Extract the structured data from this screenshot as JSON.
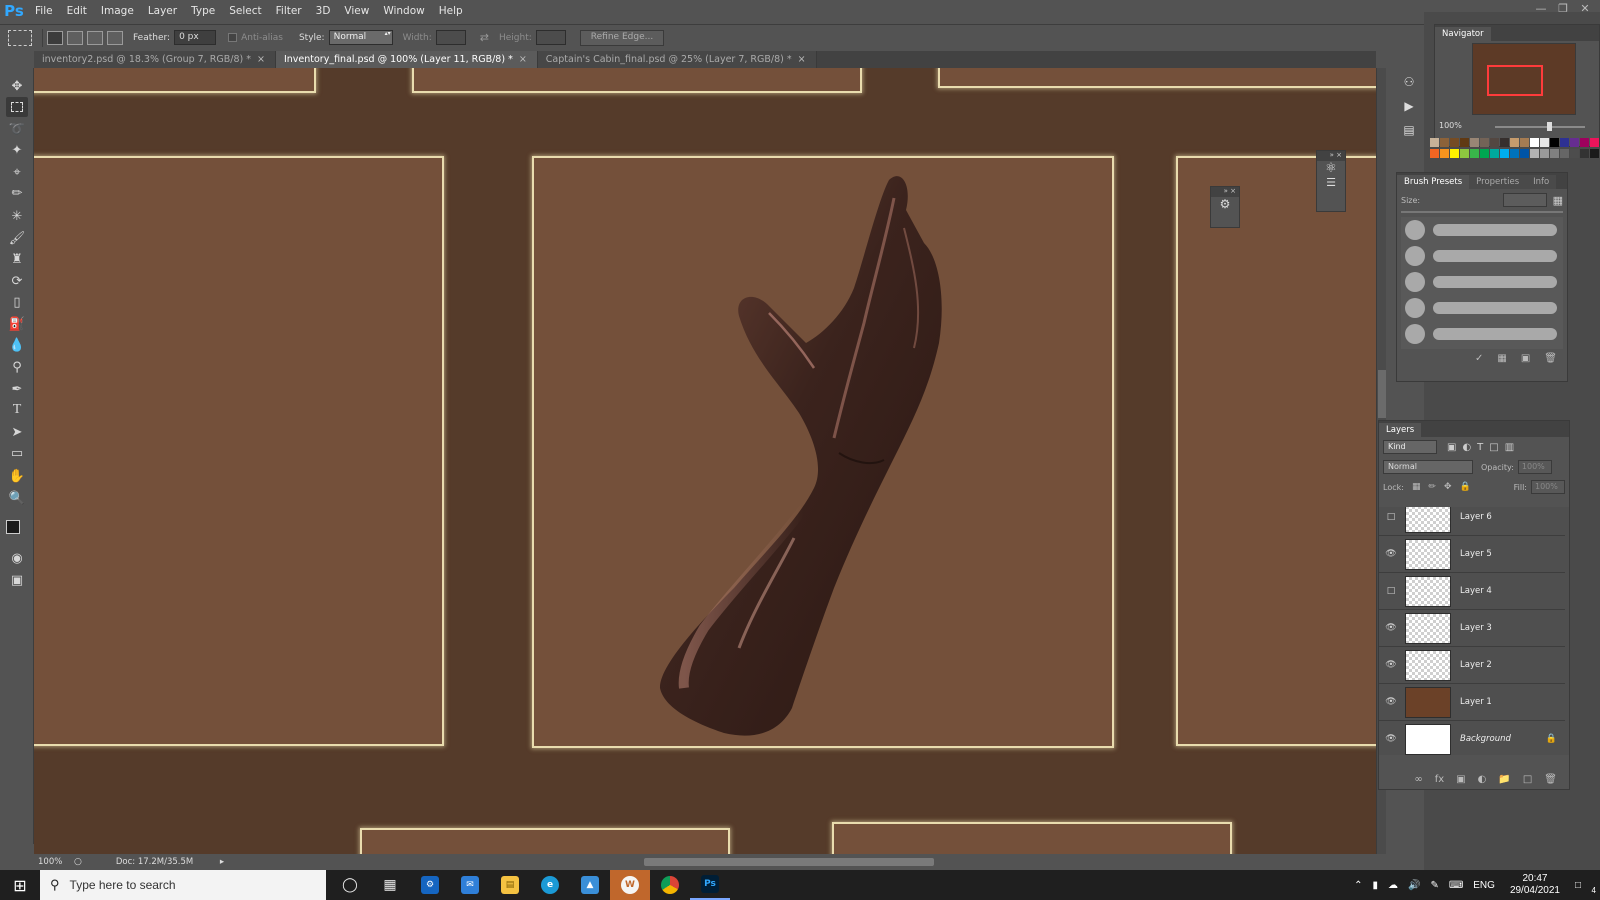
{
  "app": {
    "logo": "Ps",
    "menus": [
      "File",
      "Edit",
      "Image",
      "Layer",
      "Type",
      "Select",
      "Filter",
      "3D",
      "View",
      "Window",
      "Help"
    ],
    "window_controls": [
      "minimize-icon",
      "restore-icon",
      "close-icon"
    ]
  },
  "options_bar": {
    "feather_label": "Feather:",
    "feather_value": "0 px",
    "antialias_label": "Anti-alias",
    "style_label": "Style:",
    "style_value": "Normal",
    "width_label": "Width:",
    "height_label": "Height:",
    "refine_edge_label": "Refine Edge..."
  },
  "tabs": [
    {
      "label": "inventory2.psd @ 18.3% (Group 7, RGB/8) *",
      "active": false
    },
    {
      "label": "Inventory_final.psd @ 100% (Layer 11, RGB/8) *",
      "active": true
    },
    {
      "label": "Captain's Cabin_final.psd @ 25% (Layer 7, RGB/8) *",
      "active": false
    }
  ],
  "tools": [
    "move-tool-icon",
    "marquee-tool-icon",
    "lasso-tool-icon",
    "quick-select-tool-icon",
    "crop-tool-icon",
    "eyedropper-tool-icon",
    "healing-brush-icon",
    "brush-tool-icon",
    "clone-stamp-icon",
    "history-brush-icon",
    "eraser-tool-icon",
    "paint-bucket-icon",
    "blur-tool-icon",
    "dodge-tool-icon",
    "pen-tool-icon",
    "type-tool-icon",
    "path-select-icon",
    "rectangle-tool-icon",
    "hand-tool-icon",
    "zoom-tool-icon"
  ],
  "canvas": {
    "background": "#553b2a",
    "slot_fill": "#74503a",
    "slot_border": "#e9dcae"
  },
  "status": {
    "zoom": "100%",
    "doc_size": "Doc: 17.2M/35.5M"
  },
  "navigator": {
    "title": "Navigator",
    "zoom": "100%"
  },
  "brush_panel": {
    "tabs": [
      "Brush Presets",
      "Properties",
      "Info"
    ],
    "size_label": "Size:"
  },
  "layers_panel": {
    "title": "Layers",
    "kind_label": "Kind",
    "blend_mode": "Normal",
    "opacity_label": "Opacity:",
    "opacity_value": "100%",
    "lock_label": "Lock:",
    "fill_label": "Fill:",
    "fill_value": "100%",
    "layers": [
      {
        "name": "Layer 6",
        "visible": false
      },
      {
        "name": "Layer 5",
        "visible": true
      },
      {
        "name": "Layer 4",
        "visible": false
      },
      {
        "name": "Layer 3",
        "visible": true
      },
      {
        "name": "Layer 2",
        "visible": true
      },
      {
        "name": "Layer 1",
        "visible": true
      },
      {
        "name": "Background",
        "visible": true
      }
    ]
  },
  "taskbar": {
    "search_placeholder": "Type here to search",
    "language": "ENG",
    "time": "20:47",
    "date": "29/04/2021",
    "notification_count": "4"
  }
}
